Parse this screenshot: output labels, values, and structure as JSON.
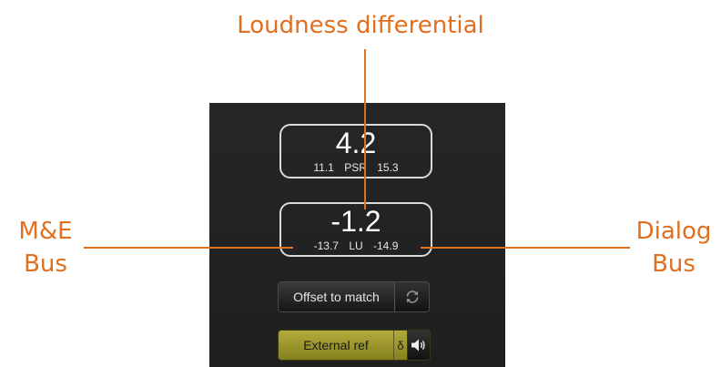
{
  "annotations": {
    "top": "Loudness differential",
    "left_line1": "M&E",
    "left_line2": "Bus",
    "right_line1": "Dialog",
    "right_line2": "Bus"
  },
  "psr_readout": {
    "value": "4.2",
    "left": "11.1",
    "unit": "PSR",
    "right": "15.3"
  },
  "lu_readout": {
    "value": "-1.2",
    "left": "-13.7",
    "unit": "LU",
    "right": "-14.9"
  },
  "buttons": {
    "offset_label": "Offset to match",
    "sync_icon": "sync-icon",
    "external_ref_label": "External ref",
    "delta_label": "δ",
    "speaker_icon": "speaker-icon"
  },
  "colors": {
    "annotation": "#e07020",
    "panel": "#222222",
    "active_button": "#a8a232"
  }
}
